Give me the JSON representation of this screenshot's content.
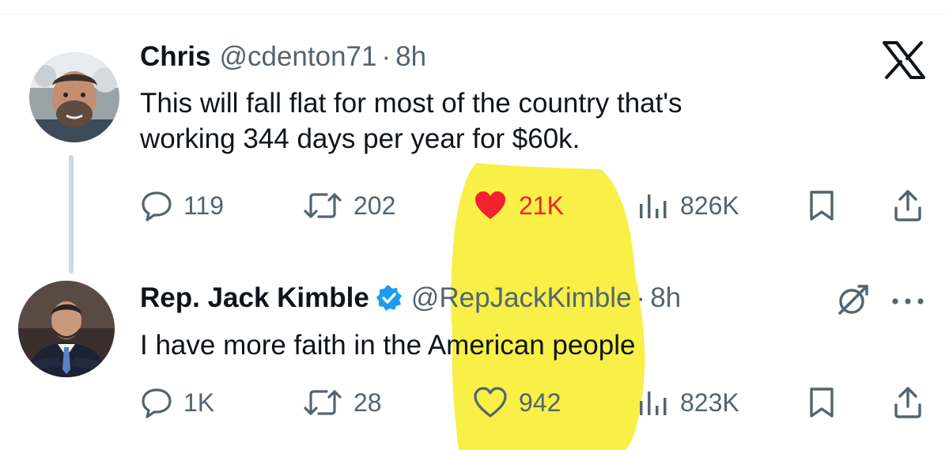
{
  "colors": {
    "text": "#0f1419",
    "muted": "#536471",
    "like": "#f4212e",
    "verified": "#1d9bf0",
    "highlight": "#f6ec1e"
  },
  "tweet1": {
    "name": "Chris",
    "handle": "@cdenton71",
    "dot": "·",
    "time": "8h",
    "text_line1": "This will fall flat for most of the country that's",
    "text_line2": "working 344 days per year for $60k.",
    "replies": "119",
    "reposts": "202",
    "likes": "21K",
    "liked": true,
    "views": "826K"
  },
  "tweet2": {
    "name": "Rep. Jack Kimble",
    "verified": true,
    "handle": "@RepJackKimble",
    "dot": "·",
    "time": "8h",
    "text": "I have more faith in the American people",
    "replies": "1K",
    "reposts": "28",
    "likes": "942",
    "liked": false,
    "views": "823K"
  },
  "icons": {
    "brand": "x-logo-icon",
    "reply": "reply-icon",
    "repost": "repost-icon",
    "like": "heart-icon",
    "views": "views-icon",
    "bookmark": "bookmark-icon",
    "share": "share-icon",
    "grok": "grok-icon",
    "more": "more-icon"
  }
}
